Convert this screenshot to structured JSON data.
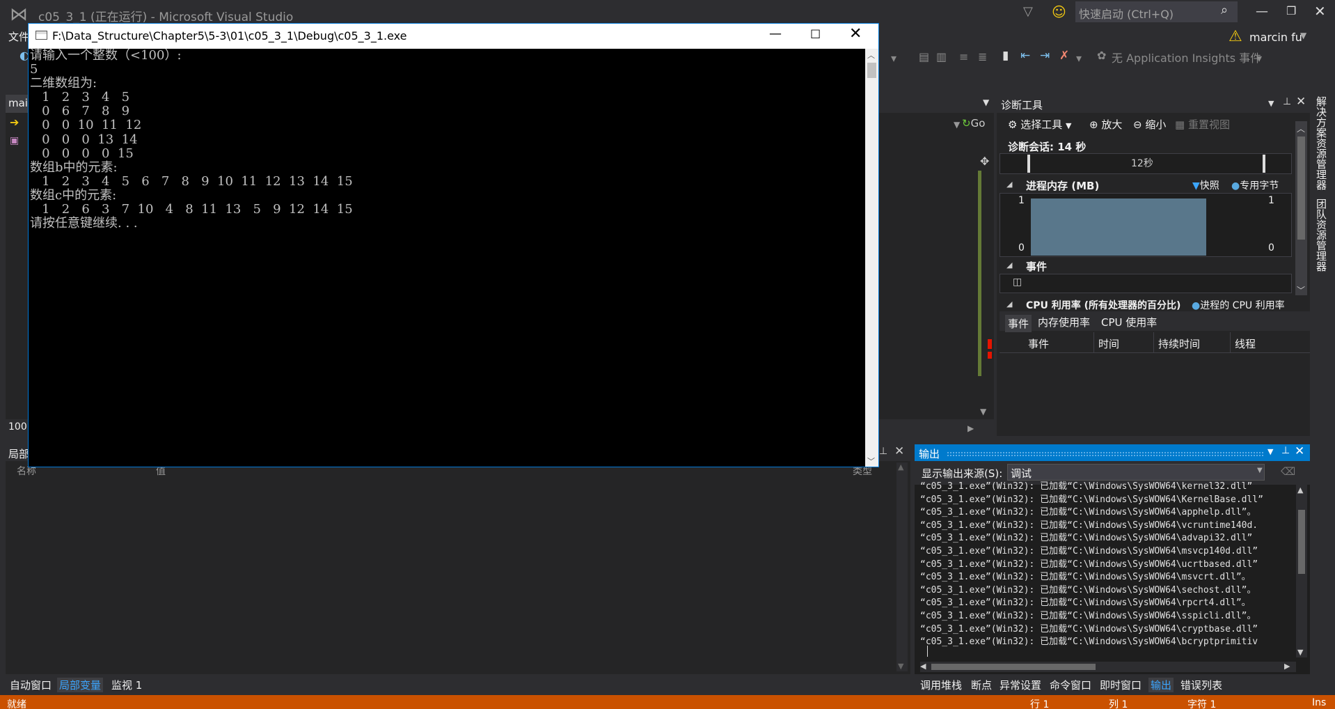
{
  "vs": {
    "title": "c05_3_1 (正在运行) - Microsoft Visual Studio",
    "quick_launch": "快速启动 (Ctrl+Q)",
    "menu_file": "文件",
    "user": "marcin fu",
    "ai_events": "无 Application Insights 事件",
    "doc_tab": "mai",
    "zoom": "100",
    "go": "Go"
  },
  "console": {
    "title": "F:\\Data_Structure\\Chapter5\\5-3\\01\\c05_3_1\\Debug\\c05_3_1.exe",
    "lines": [
      "请输入一个整数（<100）:",
      "5",
      "二维数组为:",
      "   1   2   3   4   5",
      "   0   6   7   8   9",
      "   0   0  10  11  12",
      "   0   0   0  13  14",
      "   0   0   0   0  15",
      "数组b中的元素:",
      "   1   2   3   4   5   6   7   8   9  10  11  12  13  14  15",
      "数组c中的元素:",
      "   1   2   6   3   7  10   4   8  11  13   5   9  12  14  15",
      "请按任意键继续. . ."
    ]
  },
  "diag": {
    "title": "诊断工具",
    "select_tools": "选择工具",
    "zoom_in": "放大",
    "zoom_out": "缩小",
    "reset_view": "重置视图",
    "session": "诊断会话: 14 秒",
    "tick": "12秒",
    "memory_label": "进程内存 (MB)",
    "snapshot": "快照",
    "private_bytes": "专用字节",
    "axis_max": "1",
    "axis_min": "0",
    "events": "事件",
    "cpu": "CPU 利用率 (所有处理器的百分比)",
    "cpu_legend": "进程的 CPU 利用率",
    "tabs": [
      "事件",
      "内存使用率",
      "CPU 使用率"
    ],
    "columns": [
      "事件",
      "时间",
      "持续时间",
      "线程"
    ]
  },
  "rail": {
    "solution_explorer": "解决方案资源管理器",
    "team_explorer": "团队资源管理器"
  },
  "locals": {
    "title": "局部",
    "col_name": "名称",
    "col_value": "值",
    "col_type": "类型",
    "tabs": [
      "自动窗口",
      "局部变量",
      "监视 1"
    ]
  },
  "output": {
    "title": "输出",
    "source_label": "显示输出来源(S):",
    "source_value": "调试",
    "lines": [
      "“c05_3_1.exe”(Win32): 已加载“C:\\Windows\\SysWOW64\\kernel32.dll”",
      "“c05_3_1.exe”(Win32): 已加载“C:\\Windows\\SysWOW64\\KernelBase.dll”",
      "“c05_3_1.exe”(Win32): 已加载“C:\\Windows\\SysWOW64\\apphelp.dll”。",
      "“c05_3_1.exe”(Win32): 已加载“C:\\Windows\\SysWOW64\\vcruntime140d.",
      "“c05_3_1.exe”(Win32): 已加载“C:\\Windows\\SysWOW64\\advapi32.dll”",
      "“c05_3_1.exe”(Win32): 已加载“C:\\Windows\\SysWOW64\\msvcp140d.dll”",
      "“c05_3_1.exe”(Win32): 已加载“C:\\Windows\\SysWOW64\\ucrtbased.dll”",
      "“c05_3_1.exe”(Win32): 已加载“C:\\Windows\\SysWOW64\\msvcrt.dll”。",
      "“c05_3_1.exe”(Win32): 已加载“C:\\Windows\\SysWOW64\\sechost.dll”。",
      "“c05_3_1.exe”(Win32): 已加载“C:\\Windows\\SysWOW64\\rpcrt4.dll”。",
      "“c05_3_1.exe”(Win32): 已加载“C:\\Windows\\SysWOW64\\sspicli.dll”。",
      "“c05_3_1.exe”(Win32): 已加载“C:\\Windows\\SysWOW64\\cryptbase.dll”",
      "“c05_3_1.exe”(Win32): 已加载“C:\\Windows\\SysWOW64\\bcryptprimitiv"
    ],
    "tabs": [
      "调用堆栈",
      "断点",
      "异常设置",
      "命令窗口",
      "即时窗口",
      "输出",
      "错误列表"
    ]
  },
  "status": {
    "ready": "就绪",
    "row": "行 1",
    "col": "列 1",
    "char": "字符 1",
    "ins": "Ins"
  },
  "colors": {
    "accent": "#007acc",
    "status_bar": "#ca5100",
    "memory_bar": "#59778b"
  }
}
